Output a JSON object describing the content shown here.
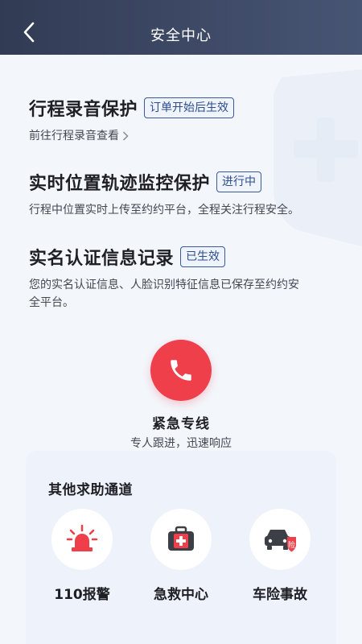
{
  "header": {
    "title": "安全中心"
  },
  "sections": [
    {
      "title": "行程录音保护",
      "badge": "订单开始后生效",
      "link": "前往行程录音查看"
    },
    {
      "title": "实时位置轨迹监控保护",
      "badge": "进行中",
      "desc": "行程中位置实时上传至约约平台，全程关注行程安全。"
    },
    {
      "title": "实名认证信息记录",
      "badge": "已生效",
      "desc_line1": "您的实名认证信息、人脸识别特征信息已保存至约约安",
      "desc_line2": "全平台。"
    }
  ],
  "emergency": {
    "title": "紧急专线",
    "subtitle": "专人跟进，迅速响应",
    "icon": "phone-icon"
  },
  "other": {
    "title": "其他求助通道",
    "channels": [
      {
        "label": "110报警",
        "icon": "police-siren-icon"
      },
      {
        "label": "急救中心",
        "icon": "first-aid-kit-icon"
      },
      {
        "label": "车险事故",
        "icon": "car-insurance-icon",
        "icon_text": "险"
      }
    ]
  },
  "colors": {
    "header": "#3a4460",
    "accent": "#2e4e8e",
    "emergency": "#ef3f4a"
  }
}
